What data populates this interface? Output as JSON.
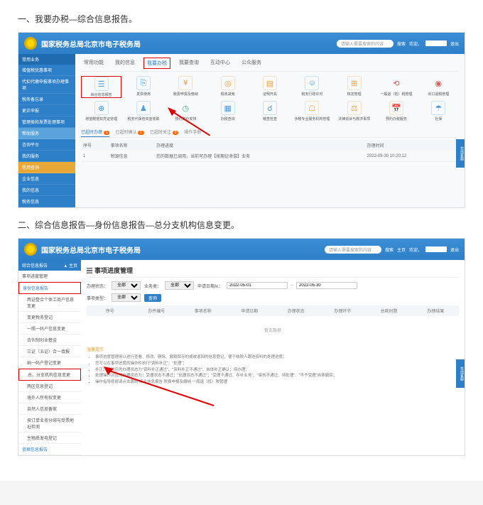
{
  "step1": "一、我要办税—综合信息报告。",
  "step2": "二、综合信息报告—身份信息报告—总分支机构信息变更。",
  "header": {
    "title": "国家税务总局北京市电子税务局",
    "search_ph": "请输入需要搜索的内容",
    "btn_search": "搜索",
    "welcome": "欢迎，",
    "exit": "退出",
    "home": "主页"
  },
  "sb1": {
    "head": "常用业务",
    "items": [
      "增值税优惠事项",
      "代扣代缴申报事项办理事项",
      "税务备忘录",
      "更正申报",
      "管理类和发票处理事项"
    ],
    "group2": "帮助服务",
    "g2items": [
      "咨询平台",
      "我的服务"
    ],
    "group3": "常用查询",
    "g3items": [
      "企业信息",
      "我的信息",
      "税务信息"
    ]
  },
  "tabs": [
    "常用功能",
    "我的信息",
    "我要办税",
    "我要查询",
    "互动中心",
    "公众服务"
  ],
  "icons": [
    {
      "n": "综合信息报告",
      "c": "c-blue",
      "g": "☰"
    },
    {
      "n": "发票使用",
      "c": "c-blue",
      "g": "⎘"
    },
    {
      "n": "税费申报及缴纳",
      "c": "c-orange",
      "g": "¥"
    },
    {
      "n": "税收减免",
      "c": "c-orange",
      "g": "◎"
    },
    {
      "n": "证明开具",
      "c": "c-orange",
      "g": "▤"
    },
    {
      "n": "税务行政许可",
      "c": "c-blue",
      "g": "☺"
    },
    {
      "n": "核定管理",
      "c": "c-orange",
      "g": "⊞"
    },
    {
      "n": "一般退（抵）税管理",
      "c": "c-red",
      "g": "⟲"
    },
    {
      "n": "出口退税管理",
      "c": "c-red",
      "g": "◉"
    },
    {
      "n": "增值税抵扣凭证管理",
      "c": "c-blue",
      "g": "⊕"
    },
    {
      "n": "税务代保管资金收取",
      "c": "c-blue",
      "g": "♟"
    },
    {
      "n": "预约定价安排",
      "c": "c-teal",
      "g": "◷"
    },
    {
      "n": "办税查询",
      "c": "c-blue",
      "g": "▦"
    },
    {
      "n": "稽查检查",
      "c": "c-blue",
      "g": "☌"
    },
    {
      "n": "涉税专业服务机构管理",
      "c": "c-orange",
      "g": "☖"
    },
    {
      "n": "法律追诉与救济事项",
      "c": "c-orange",
      "g": "⚖"
    },
    {
      "n": "预约办税服务",
      "c": "c-orange",
      "g": "📅"
    },
    {
      "n": "社保",
      "c": "c-blue",
      "g": "☂"
    }
  ],
  "subtabs": [
    {
      "l": "已超时办理",
      "b": "1"
    },
    {
      "l": "已超时确认",
      "b": "0"
    },
    {
      "l": "已超时关注",
      "b": "0"
    },
    {
      "l": "操作手册"
    }
  ],
  "tbl": {
    "cols": [
      "序号",
      "事项名称",
      "办理进度",
      "办理时间"
    ],
    "rows": [
      [
        "1",
        "税源信息",
        "您的数据已调用，当前可办理【按期征收偿】业务",
        "2022-05-30 10:20:12"
      ]
    ]
  },
  "assist": "在线客服",
  "sb2": {
    "head": "综合信息报告",
    "home": "▲ 主页",
    "items": [
      {
        "l": "事项进度管理"
      },
      {
        "l": "身份信息报告",
        "box": 1,
        "sel": 1
      },
      {
        "l": "两证整合个体工商户信息变更",
        "sub": 1
      },
      {
        "l": "变更税务登记",
        "sub": 1
      },
      {
        "l": "一照一码户信息变更",
        "sub": 1
      },
      {
        "l": "合伙制创业基金",
        "sub": 1
      },
      {
        "l": "三证（五证）合一填报",
        "sub": 1
      },
      {
        "l": "纳一码户登记变更",
        "sub": 1
      },
      {
        "l": "总、分支机构信息变更",
        "box": 1,
        "sub": 1
      },
      {
        "l": "两区信息登记",
        "sub": 1
      },
      {
        "l": "境外人所有权变更",
        "sub": 1
      },
      {
        "l": "自然人信息备案",
        "sub": 1
      },
      {
        "l": "按订单业务分绑与受票地址检测",
        "sub": 1
      },
      {
        "l": "生物质发电登记",
        "sub": 1
      }
    ],
    "grp2": "资格信息报告"
  },
  "panel2": {
    "title": "事项进度管理",
    "f": {
      "l1": "办理状态：",
      "v1": "全部",
      "l2": "业务类：",
      "v2": "全部",
      "l3": "申请日期从：",
      "d1": "2022-05-01",
      "d2": "2022-05-30"
    },
    "f2": {
      "l": "事项类型：",
      "v": "全部"
    },
    "q": "查询",
    "cols": [
      "序号",
      "办件编号",
      "事项名称",
      "申请日期",
      "办理状态",
      "办理环节",
      "总耗时数",
      "办理结果"
    ],
    "empty": "暂无数据",
    "notice": "温馨提示",
    "notes": [
      "事项进度管理用以进行查看、修改、删除、撤销保存的或被退回的信息登记，便于纳税人跟进资料的处理进度；",
      "您可以在事项进度的操作栏执行\"资料补正\"、\"处理\"；",
      "补正）只对应的办理状态为\"资料补正通过\"、\"资料补正不通过\"、自体补正确认；待办理；",
      "处理操作对应的办理状态为：受理状态不通过；\"处理状态不通过\"；\"受理不通过、存补业务\"、\"审核不通过、待处理\"、\"不予受理\"自体撤回；",
      "操作指导视频请点击跳转 综合信息报告 税费申报及缴纳 一般退（抵）税管理"
    ]
  }
}
